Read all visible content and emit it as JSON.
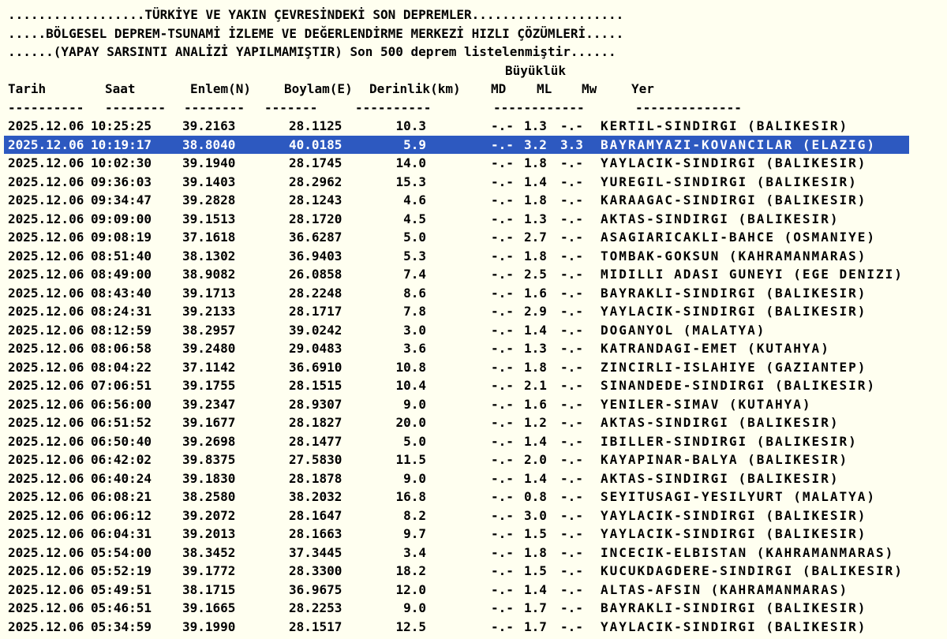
{
  "page": {
    "background_color": "#FFFFF0",
    "text_color": "#000000",
    "highlight_color": "#2D59C0",
    "highlight_text_color": "#FFFFFF"
  },
  "header": {
    "line1": "..................TÜRKİYE VE YAKIN ÇEVRESİNDEKİ SON DEPREMLER....................",
    "line2": ".....BÖLGESEL DEPREM-TSUNAMİ İZLEME VE DEĞERLENDİRME MERKEZİ HIZLI ÇÖZÜMLERİ.....",
    "line3": "......(YAPAY SARSINTI ANALİZİ YAPILMAMIŞTIR) Son 500 deprem listelenmiştir......"
  },
  "table": {
    "magnitude_group_label": "Büyüklük",
    "columns": {
      "tarih": "Tarih",
      "saat": "Saat",
      "enlem": "Enlem(N)",
      "boylam": "Boylam(E)",
      "derinlik": "Derinlik(km)",
      "md": "MD",
      "ml": "ML",
      "mw": "Mw",
      "yer": "Yer"
    },
    "separators": [
      "----------",
      "--------",
      "--------",
      "-------",
      "----------",
      "------------",
      "--------------"
    ],
    "rows": [
      {
        "date": "2025.12.06",
        "time": "10:25:25",
        "lat": "39.2163",
        "lon": "28.1125",
        "depth": "10.3",
        "md": "-.-",
        "ml": "1.3",
        "mw": "-.-",
        "place": "KERTIL-SINDIRGI (BALIKESIR)",
        "highlight": false
      },
      {
        "date": "2025.12.06",
        "time": "10:19:17",
        "lat": "38.8040",
        "lon": "40.0185",
        "depth": "5.9",
        "md": "-.-",
        "ml": "3.2",
        "mw": "3.3",
        "place": "BAYRAMYAZI-KOVANCILAR (ELAZIG)",
        "highlight": true
      },
      {
        "date": "2025.12.06",
        "time": "10:02:30",
        "lat": "39.1940",
        "lon": "28.1745",
        "depth": "14.0",
        "md": "-.-",
        "ml": "1.8",
        "mw": "-.-",
        "place": "YAYLACIK-SINDIRGI (BALIKESIR)",
        "highlight": false
      },
      {
        "date": "2025.12.06",
        "time": "09:36:03",
        "lat": "39.1403",
        "lon": "28.2962",
        "depth": "15.3",
        "md": "-.-",
        "ml": "1.4",
        "mw": "-.-",
        "place": "YUREGIL-SINDIRGI (BALIKESIR)",
        "highlight": false
      },
      {
        "date": "2025.12.06",
        "time": "09:34:47",
        "lat": "39.2828",
        "lon": "28.1243",
        "depth": "4.6",
        "md": "-.-",
        "ml": "1.8",
        "mw": "-.-",
        "place": "KARAAGAC-SINDIRGI (BALIKESIR)",
        "highlight": false
      },
      {
        "date": "2025.12.06",
        "time": "09:09:00",
        "lat": "39.1513",
        "lon": "28.1720",
        "depth": "4.5",
        "md": "-.-",
        "ml": "1.3",
        "mw": "-.-",
        "place": "AKTAS-SINDIRGI (BALIKESIR)",
        "highlight": false
      },
      {
        "date": "2025.12.06",
        "time": "09:08:19",
        "lat": "37.1618",
        "lon": "36.6287",
        "depth": "5.0",
        "md": "-.-",
        "ml": "2.7",
        "mw": "-.-",
        "place": "ASAGIARICAKLI-BAHCE (OSMANIYE)",
        "highlight": false
      },
      {
        "date": "2025.12.06",
        "time": "08:51:40",
        "lat": "38.1302",
        "lon": "36.9403",
        "depth": "5.3",
        "md": "-.-",
        "ml": "1.8",
        "mw": "-.-",
        "place": "TOMBAK-GOKSUN (KAHRAMANMARAS)",
        "highlight": false
      },
      {
        "date": "2025.12.06",
        "time": "08:49:00",
        "lat": "38.9082",
        "lon": "26.0858",
        "depth": "7.4",
        "md": "-.-",
        "ml": "2.5",
        "mw": "-.-",
        "place": "MIDILLI ADASI GUNEYI (EGE DENIZI)",
        "highlight": false
      },
      {
        "date": "2025.12.06",
        "time": "08:43:40",
        "lat": "39.1713",
        "lon": "28.2248",
        "depth": "8.6",
        "md": "-.-",
        "ml": "1.6",
        "mw": "-.-",
        "place": "BAYRAKLI-SINDIRGI (BALIKESIR)",
        "highlight": false
      },
      {
        "date": "2025.12.06",
        "time": "08:24:31",
        "lat": "39.2133",
        "lon": "28.1717",
        "depth": "7.8",
        "md": "-.-",
        "ml": "2.9",
        "mw": "-.-",
        "place": "YAYLACIK-SINDIRGI (BALIKESIR)",
        "highlight": false
      },
      {
        "date": "2025.12.06",
        "time": "08:12:59",
        "lat": "38.2957",
        "lon": "39.0242",
        "depth": "3.0",
        "md": "-.-",
        "ml": "1.4",
        "mw": "-.-",
        "place": "DOGANYOL (MALATYA)",
        "highlight": false
      },
      {
        "date": "2025.12.06",
        "time": "08:06:58",
        "lat": "39.2480",
        "lon": "29.0483",
        "depth": "3.6",
        "md": "-.-",
        "ml": "1.3",
        "mw": "-.-",
        "place": "KATRANDAGI-EMET (KUTAHYA)",
        "highlight": false
      },
      {
        "date": "2025.12.06",
        "time": "08:04:22",
        "lat": "37.1142",
        "lon": "36.6910",
        "depth": "10.8",
        "md": "-.-",
        "ml": "1.8",
        "mw": "-.-",
        "place": "ZINCIRLI-ISLAHIYE (GAZIANTEP)",
        "highlight": false
      },
      {
        "date": "2025.12.06",
        "time": "07:06:51",
        "lat": "39.1755",
        "lon": "28.1515",
        "depth": "10.4",
        "md": "-.-",
        "ml": "2.1",
        "mw": "-.-",
        "place": "SINANDEDE-SINDIRGI (BALIKESIR)",
        "highlight": false
      },
      {
        "date": "2025.12.06",
        "time": "06:56:00",
        "lat": "39.2347",
        "lon": "28.9307",
        "depth": "9.0",
        "md": "-.-",
        "ml": "1.6",
        "mw": "-.-",
        "place": "YENILER-SIMAV (KUTAHYA)",
        "highlight": false
      },
      {
        "date": "2025.12.06",
        "time": "06:51:52",
        "lat": "39.1677",
        "lon": "28.1827",
        "depth": "20.0",
        "md": "-.-",
        "ml": "1.2",
        "mw": "-.-",
        "place": "AKTAS-SINDIRGI (BALIKESIR)",
        "highlight": false
      },
      {
        "date": "2025.12.06",
        "time": "06:50:40",
        "lat": "39.2698",
        "lon": "28.1477",
        "depth": "5.0",
        "md": "-.-",
        "ml": "1.4",
        "mw": "-.-",
        "place": "IBILLER-SINDIRGI (BALIKESIR)",
        "highlight": false
      },
      {
        "date": "2025.12.06",
        "time": "06:42:02",
        "lat": "39.8375",
        "lon": "27.5830",
        "depth": "11.5",
        "md": "-.-",
        "ml": "2.0",
        "mw": "-.-",
        "place": "KAYAPINAR-BALYA (BALIKESIR)",
        "highlight": false
      },
      {
        "date": "2025.12.06",
        "time": "06:40:24",
        "lat": "39.1830",
        "lon": "28.1878",
        "depth": "9.0",
        "md": "-.-",
        "ml": "1.4",
        "mw": "-.-",
        "place": "AKTAS-SINDIRGI (BALIKESIR)",
        "highlight": false
      },
      {
        "date": "2025.12.06",
        "time": "06:08:21",
        "lat": "38.2580",
        "lon": "38.2032",
        "depth": "16.8",
        "md": "-.-",
        "ml": "0.8",
        "mw": "-.-",
        "place": "SEYITUSAGI-YESILYURT (MALATYA)",
        "highlight": false
      },
      {
        "date": "2025.12.06",
        "time": "06:06:12",
        "lat": "39.2072",
        "lon": "28.1647",
        "depth": "8.2",
        "md": "-.-",
        "ml": "3.0",
        "mw": "-.-",
        "place": "YAYLACIK-SINDIRGI (BALIKESIR)",
        "highlight": false
      },
      {
        "date": "2025.12.06",
        "time": "06:04:31",
        "lat": "39.2013",
        "lon": "28.1663",
        "depth": "9.7",
        "md": "-.-",
        "ml": "1.5",
        "mw": "-.-",
        "place": "YAYLACIK-SINDIRGI (BALIKESIR)",
        "highlight": false
      },
      {
        "date": "2025.12.06",
        "time": "05:54:00",
        "lat": "38.3452",
        "lon": "37.3445",
        "depth": "3.4",
        "md": "-.-",
        "ml": "1.8",
        "mw": "-.-",
        "place": "INCECIK-ELBISTAN (KAHRAMANMARAS)",
        "highlight": false
      },
      {
        "date": "2025.12.06",
        "time": "05:52:19",
        "lat": "39.1772",
        "lon": "28.3300",
        "depth": "18.2",
        "md": "-.-",
        "ml": "1.5",
        "mw": "-.-",
        "place": "KUCUKDAGDERE-SINDIRGI (BALIKESIR)",
        "highlight": false
      },
      {
        "date": "2025.12.06",
        "time": "05:49:51",
        "lat": "38.1715",
        "lon": "36.9675",
        "depth": "12.0",
        "md": "-.-",
        "ml": "1.4",
        "mw": "-.-",
        "place": "ALTAS-AFSIN (KAHRAMANMARAS)",
        "highlight": false
      },
      {
        "date": "2025.12.06",
        "time": "05:46:51",
        "lat": "39.1665",
        "lon": "28.2253",
        "depth": "9.0",
        "md": "-.-",
        "ml": "1.7",
        "mw": "-.-",
        "place": "BAYRAKLI-SINDIRGI (BALIKESIR)",
        "highlight": false
      },
      {
        "date": "2025.12.06",
        "time": "05:34:59",
        "lat": "39.1990",
        "lon": "28.1517",
        "depth": "12.5",
        "md": "-.-",
        "ml": "1.7",
        "mw": "-.-",
        "place": "YAYLACIK-SINDIRGI (BALIKESIR)",
        "highlight": false
      }
    ]
  }
}
